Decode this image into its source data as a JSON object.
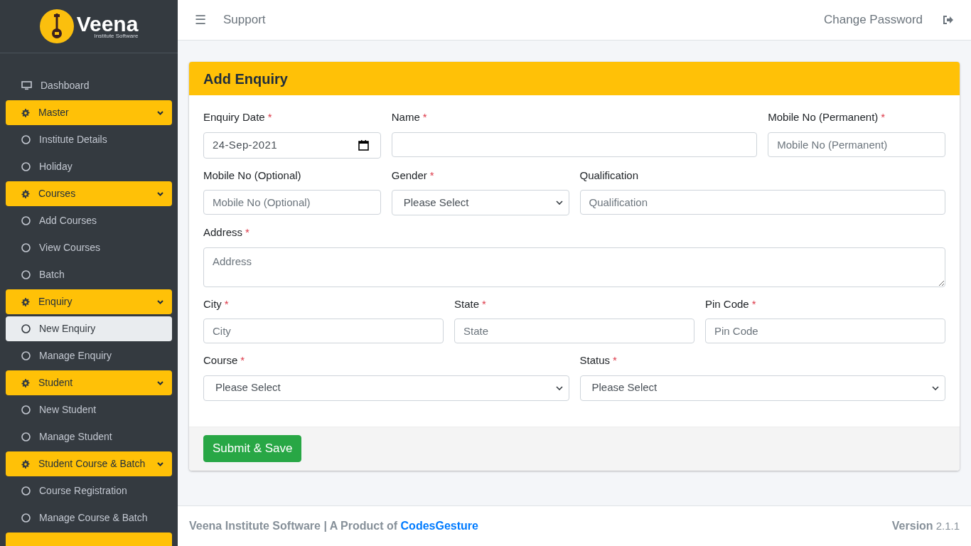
{
  "brand": {
    "name": "Veena",
    "tagline": "Institute Software"
  },
  "sidebar": {
    "items": [
      {
        "kind": "link",
        "label": "Dashboard",
        "selected": false
      },
      {
        "kind": "group",
        "label": "Master",
        "expanded": true,
        "children": [
          {
            "label": "Institute Details",
            "selected": false
          },
          {
            "label": "Holiday",
            "selected": false
          }
        ]
      },
      {
        "kind": "group",
        "label": "Courses",
        "expanded": true,
        "children": [
          {
            "label": "Add Courses",
            "selected": false
          },
          {
            "label": "View Courses",
            "selected": false
          },
          {
            "label": "Batch",
            "selected": false
          }
        ]
      },
      {
        "kind": "group",
        "label": "Enquiry",
        "expanded": true,
        "children": [
          {
            "label": "New Enquiry",
            "selected": true
          },
          {
            "label": "Manage Enquiry",
            "selected": false
          }
        ]
      },
      {
        "kind": "group",
        "label": "Student",
        "expanded": true,
        "children": [
          {
            "label": "New Student",
            "selected": false
          },
          {
            "label": "Manage Student",
            "selected": false
          }
        ]
      },
      {
        "kind": "group",
        "label": "Student Course & Batch",
        "expanded": true,
        "children": [
          {
            "label": "Course Registration",
            "selected": false
          },
          {
            "label": "Manage Course & Batch",
            "selected": false
          }
        ]
      },
      {
        "kind": "group"
      }
    ]
  },
  "topbar": {
    "menu_icon": "☰",
    "links": [
      "Support"
    ],
    "right_link": "Change Password"
  },
  "form": {
    "title": "Add Enquiry",
    "rows": [
      [
        {
          "label": "Enquiry Date",
          "required_mark": "*",
          "kind": "date",
          "value": "24-Sep-2021"
        },
        {
          "label": "Name",
          "required_mark": "*",
          "kind": "text"
        },
        {
          "label": "Mobile No (Permanent)",
          "required_mark": "*",
          "kind": "text",
          "placeholder": "Mobile No (Permanent)"
        }
      ],
      [
        {
          "label": "Mobile No (Optional)",
          "kind": "text",
          "placeholder": "Mobile No (Optional)"
        },
        {
          "label": "Gender",
          "required_mark": "*",
          "kind": "select",
          "value": "Please Select"
        },
        {
          "label": "Qualification",
          "kind": "text",
          "placeholder": "Qualification"
        }
      ],
      [
        {
          "label": "Address",
          "required_mark": "*",
          "kind": "textarea",
          "placeholder": "Address"
        }
      ],
      [
        {
          "label": "City",
          "required_mark": "*",
          "kind": "text",
          "placeholder": "City"
        },
        {
          "label": "State",
          "required_mark": "*",
          "kind": "text",
          "placeholder": "State"
        },
        {
          "label": "Pin Code",
          "required_mark": "*",
          "kind": "text",
          "placeholder": "Pin Code"
        }
      ],
      [
        {
          "label": "Course",
          "required_mark": "*",
          "kind": "select",
          "value": "Please Select"
        },
        {
          "label": "Status",
          "required_mark": "*",
          "kind": "select",
          "value": "Please Select"
        }
      ]
    ],
    "submit": "Submit & Save"
  },
  "footer": {
    "text": "Veena Institute Software | A Product of",
    "link": "CodesGesture",
    "version_label": "Version",
    "version": "2.1.1"
  }
}
